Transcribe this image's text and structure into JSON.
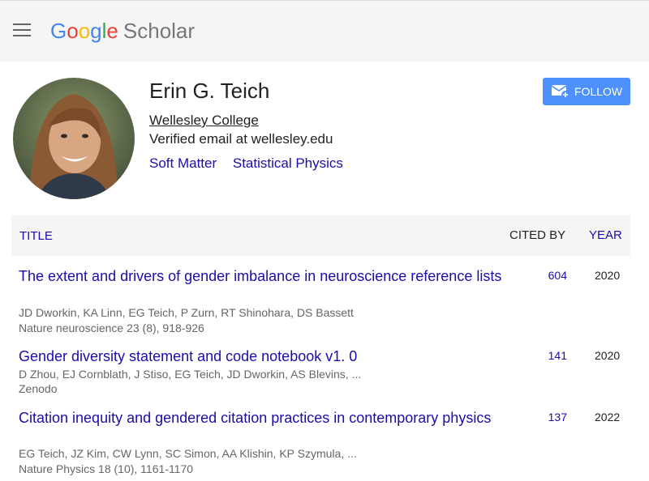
{
  "header": {
    "logo_google": "Google",
    "logo_scholar": "Scholar"
  },
  "profile": {
    "name": "Erin G. Teich",
    "affiliation": "Wellesley College",
    "email": "Verified email at wellesley.edu",
    "interests": [
      "Soft Matter",
      "Statistical Physics"
    ],
    "follow_label": "FOLLOW"
  },
  "table": {
    "col_title": "TITLE",
    "col_cited": "CITED BY",
    "col_year": "YEAR",
    "rows": [
      {
        "title": "The extent and drivers of gender imbalance in neuroscience reference lists",
        "authors": "JD Dworkin, KA Linn, EG Teich, P Zurn, RT Shinohara, DS Bassett",
        "venue": "Nature neuroscience 23 (8), 918-926",
        "cited": "604",
        "year": "2020"
      },
      {
        "title": "Gender diversity statement and code notebook v1. 0",
        "authors": "D Zhou, EJ Cornblath, J Stiso, EG Teich, JD Dworkin, AS Blevins, ...",
        "venue": "Zenodo",
        "cited": "141",
        "year": "2020"
      },
      {
        "title": "Citation inequity and gendered citation practices in contemporary physics",
        "authors": "EG Teich, JZ Kim, CW Lynn, SC Simon, AA Klishin, KP Szymula, ...",
        "venue": "Nature Physics 18 (10), 1161-1170",
        "cited": "137",
        "year": "2022"
      }
    ]
  },
  "colors": {
    "link": "#1a0dab",
    "follow_button": "#4d90fe",
    "header_bg": "#f5f5f5"
  }
}
